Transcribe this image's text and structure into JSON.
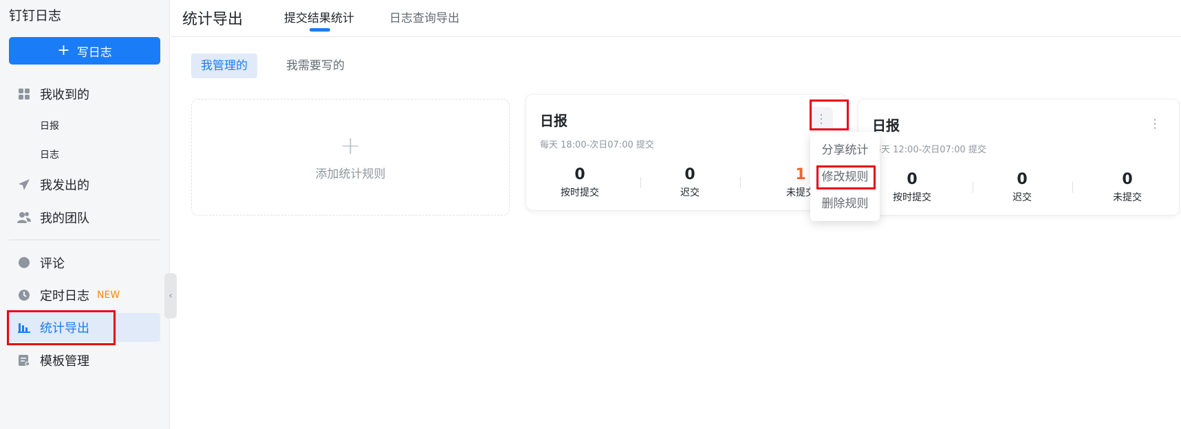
{
  "app": {
    "title": "钉钉日志"
  },
  "sidebar": {
    "write_button": {
      "label": "写日志",
      "icon": "plus-icon"
    },
    "items": [
      {
        "label": "我收到的",
        "icon": "grid-icon"
      },
      {
        "label": "日报"
      },
      {
        "label": "日志"
      },
      {
        "label": "我发出的",
        "icon": "paper-plane-icon"
      },
      {
        "label": "我的团队",
        "icon": "users-icon"
      },
      {
        "label": "评论",
        "icon": "comment-icon"
      },
      {
        "label": "定时日志",
        "icon": "clock-icon",
        "badge": "NEW"
      },
      {
        "label": "统计导出",
        "icon": "bar-chart-icon",
        "active": true
      },
      {
        "label": "模板管理",
        "icon": "template-icon"
      }
    ]
  },
  "header": {
    "title": "统计导出",
    "tabs": [
      {
        "label": "提交结果统计",
        "active": true
      },
      {
        "label": "日志查询导出",
        "active": false
      }
    ]
  },
  "segments": [
    {
      "label": "我管理的",
      "active": true
    },
    {
      "label": "我需要写的",
      "active": false
    }
  ],
  "add_card": {
    "label": "添加统计规则"
  },
  "cards": [
    {
      "name": "日报",
      "time": "每天 18:00-次日07:00 提交",
      "stats": [
        {
          "value": "0",
          "label": "按时提交"
        },
        {
          "value": "0",
          "label": "迟交"
        },
        {
          "value": "1",
          "label": "未提交"
        }
      ]
    },
    {
      "name": "日报",
      "time": "每天 12:00-次日07:00 提交",
      "stats": [
        {
          "value": "0",
          "label": "按时提交"
        },
        {
          "value": "0",
          "label": "迟交"
        },
        {
          "value": "0",
          "label": "未提交"
        }
      ]
    }
  ],
  "menu": {
    "items": [
      {
        "label": "分享统计"
      },
      {
        "label": "修改规则"
      },
      {
        "label": "删除规则"
      }
    ]
  },
  "colors": {
    "accent": "#1a7cf6",
    "warning": "#f7602f",
    "highlight": "#e60012",
    "badge": "#ff8800"
  }
}
